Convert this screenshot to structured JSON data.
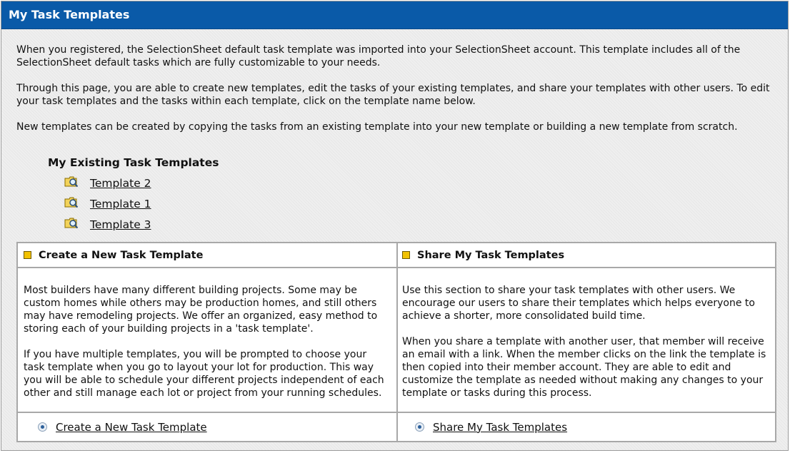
{
  "header": {
    "title": "My Task Templates"
  },
  "intro": {
    "paragraphs": [
      "When you registered, the SelectionSheet default task template was imported into your SelectionSheet account. This template includes all of the SelectionSheet default tasks which are fully customizable to your needs.",
      "Through this page, you are able to create new templates, edit the tasks of your existing templates, and share your templates with other users. To edit your task templates and the tasks within each template, click on the template name below.",
      "New templates can be created by copying the tasks from an existing template into your new template or building a new template from scratch."
    ]
  },
  "existing": {
    "heading": "My Existing Task Templates",
    "templates": [
      {
        "label": "Template 2",
        "icon": "folder-search-icon"
      },
      {
        "label": "Template 1",
        "icon": "folder-search-icon"
      },
      {
        "label": "Template 3",
        "icon": "folder-search-icon"
      }
    ]
  },
  "create_section": {
    "heading": "Create a New Task Template",
    "paragraphs": [
      "Most builders have many different building projects. Some may be custom homes while others may be production homes, and still others may have remodeling projects. We offer an organized, easy method to storing each of your building projects in a 'task template'.",
      "If you have multiple templates, you will be prompted to choose your task template when you go to layout your lot for production. This way you will be able to schedule your different projects independent of each other and still manage each lot or project from your running schedules."
    ],
    "link": "Create a New Task Template"
  },
  "share_section": {
    "heading": "Share My Task Templates",
    "paragraphs": [
      "Use this section to share your task templates with other users. We encourage our users to share their templates which helps everyone to achieve a shorter, more consolidated build time.",
      "When you share a template with another user, that member will receive an email with a link. When the member clicks on the link the template is then copied into their member account. They are able to edit and customize the template as needed without making any changes to your template or tasks during this process."
    ],
    "link": "Share My Task Templates"
  },
  "colors": {
    "header_bg": "#0a5aa8",
    "bullet": "#f2c200",
    "border": "#a8a8a8"
  }
}
